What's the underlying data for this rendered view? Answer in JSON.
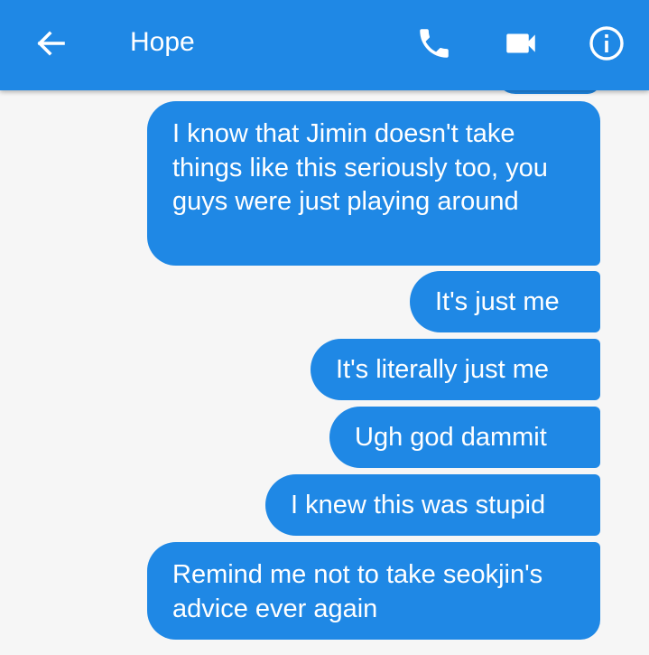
{
  "header": {
    "title": "Hope",
    "back_icon": "arrow-back-icon",
    "call_icon": "phone-icon",
    "video_icon": "video-camera-icon",
    "info_icon": "info-icon",
    "color": "#1f88e5"
  },
  "messages": [
    {
      "sender": "me",
      "text": "I know that Jimin doesn't take things like this seriously too, you guys were just playing around"
    },
    {
      "sender": "me",
      "text": "It's just me"
    },
    {
      "sender": "me",
      "text": "It's literally just me"
    },
    {
      "sender": "me",
      "text": "Ugh god dammit"
    },
    {
      "sender": "me",
      "text": "I knew this was stupid"
    },
    {
      "sender": "me",
      "text": "Remind me not to take seokjin's advice ever again"
    }
  ],
  "colors": {
    "bubble": "#1f88e5",
    "background": "#f6f6f6",
    "text_on_blue": "#ffffff"
  }
}
